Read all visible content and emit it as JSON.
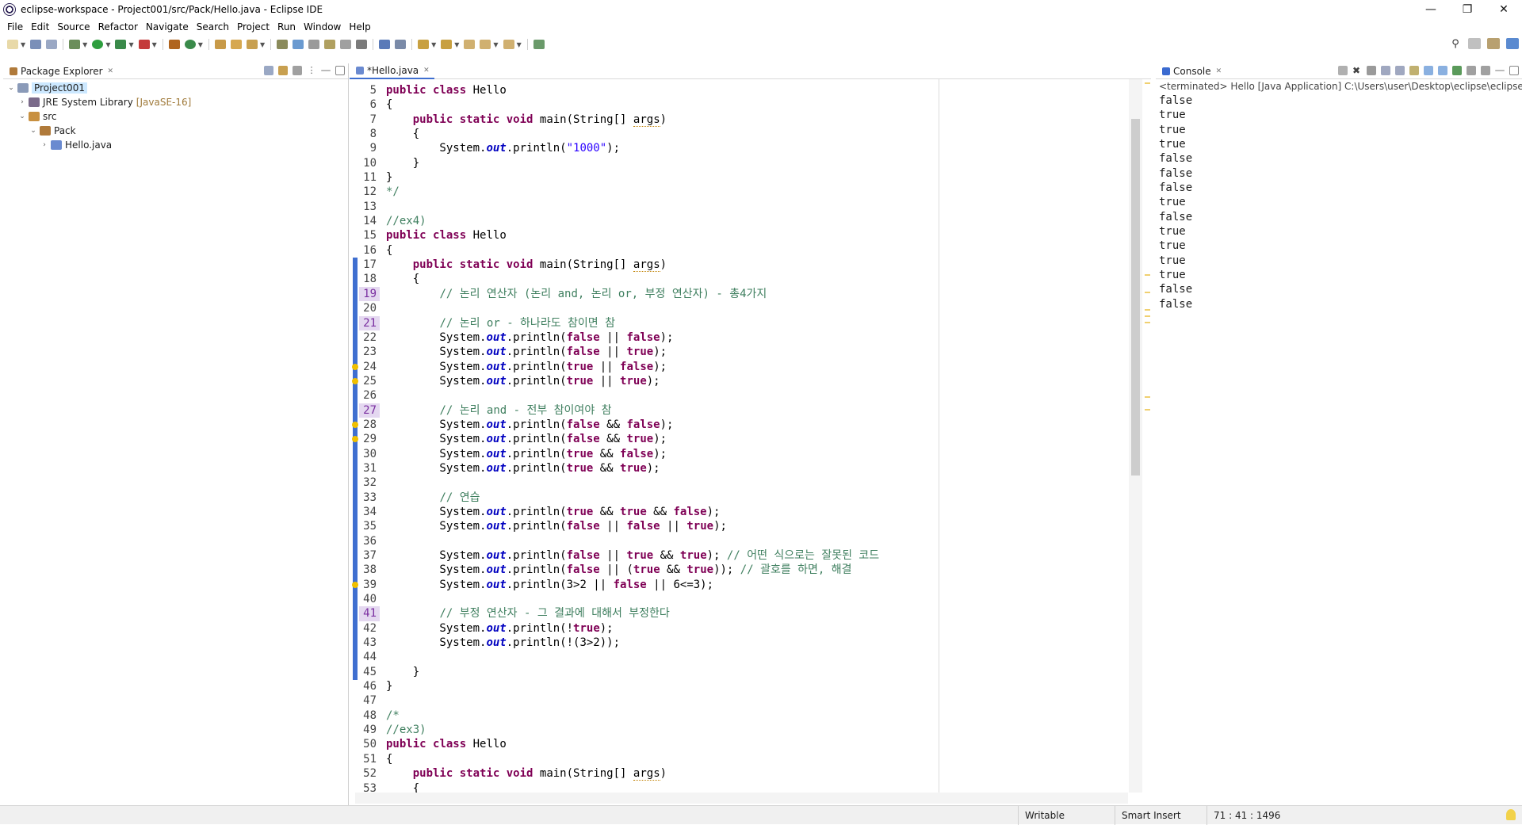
{
  "window": {
    "title": "eclipse-workspace - Project001/src/Pack/Hello.java - Eclipse IDE"
  },
  "menu": [
    "File",
    "Edit",
    "Source",
    "Refactor",
    "Navigate",
    "Search",
    "Project",
    "Run",
    "Window",
    "Help"
  ],
  "package_explorer": {
    "tab_label": "Package Explorer",
    "tree": [
      {
        "label": "Project001",
        "decoration": "",
        "expanded": true,
        "depth": 0,
        "icon": "project-icon",
        "selected": true
      },
      {
        "label": "JRE System Library",
        "decoration": "[JavaSE-16]",
        "expanded": false,
        "depth": 1,
        "icon": "library-icon",
        "selected": false
      },
      {
        "label": "src",
        "decoration": "",
        "expanded": true,
        "depth": 1,
        "icon": "source-folder-icon",
        "selected": false
      },
      {
        "label": "Pack",
        "decoration": "",
        "expanded": true,
        "depth": 2,
        "icon": "package-icon",
        "selected": false
      },
      {
        "label": "Hello.java",
        "decoration": "",
        "expanded": false,
        "depth": 3,
        "icon": "java-file-icon",
        "selected": false
      }
    ]
  },
  "editor": {
    "tab_label": "*Hello.java",
    "lines": [
      {
        "n": "5",
        "text": "public class Hello",
        "hl": false,
        "changed": false,
        "warn": false
      },
      {
        "n": "6",
        "text": "{",
        "hl": false,
        "changed": false,
        "warn": false
      },
      {
        "n": "7",
        "text": "    public static void main(String[] args)",
        "hl": false,
        "changed": false,
        "warn": false
      },
      {
        "n": "8",
        "text": "    {",
        "hl": false,
        "changed": false,
        "warn": false
      },
      {
        "n": "9",
        "text": "        System.out.println(\"1000\");",
        "hl": false,
        "changed": false,
        "warn": false
      },
      {
        "n": "10",
        "text": "    }",
        "hl": false,
        "changed": false,
        "warn": false
      },
      {
        "n": "11",
        "text": "}",
        "hl": false,
        "changed": false,
        "warn": false
      },
      {
        "n": "12",
        "text": "*/",
        "hl": false,
        "changed": false,
        "warn": false
      },
      {
        "n": "13",
        "text": "",
        "hl": false,
        "changed": false,
        "warn": false
      },
      {
        "n": "14",
        "text": "//ex4)",
        "hl": false,
        "changed": false,
        "warn": false
      },
      {
        "n": "15",
        "text": "public class Hello",
        "hl": false,
        "changed": false,
        "warn": false
      },
      {
        "n": "16",
        "text": "{",
        "hl": false,
        "changed": false,
        "warn": false
      },
      {
        "n": "17",
        "text": "    public static void main(String[] args)",
        "hl": false,
        "changed": true,
        "warn": false
      },
      {
        "n": "18",
        "text": "    {",
        "hl": false,
        "changed": true,
        "warn": false
      },
      {
        "n": "19",
        "text": "        // 논리 연산자 (논리 and, 논리 or, 부정 연산자) - 총4가지",
        "hl": true,
        "changed": true,
        "warn": false
      },
      {
        "n": "20",
        "text": "",
        "hl": false,
        "changed": true,
        "warn": false
      },
      {
        "n": "21",
        "text": "        // 논리 or - 하나라도 참이면 참",
        "hl": true,
        "changed": true,
        "warn": false
      },
      {
        "n": "22",
        "text": "        System.out.println(false || false);",
        "hl": false,
        "changed": true,
        "warn": false
      },
      {
        "n": "23",
        "text": "        System.out.println(false || true);",
        "hl": false,
        "changed": true,
        "warn": false
      },
      {
        "n": "24",
        "text": "        System.out.println(true || false);",
        "hl": false,
        "changed": true,
        "warn": true
      },
      {
        "n": "25",
        "text": "        System.out.println(true || true);",
        "hl": false,
        "changed": true,
        "warn": true
      },
      {
        "n": "26",
        "text": "",
        "hl": false,
        "changed": true,
        "warn": false
      },
      {
        "n": "27",
        "text": "        // 논리 and - 전부 참이여야 참",
        "hl": true,
        "changed": true,
        "warn": false
      },
      {
        "n": "28",
        "text": "        System.out.println(false && false);",
        "hl": false,
        "changed": true,
        "warn": true
      },
      {
        "n": "29",
        "text": "        System.out.println(false && true);",
        "hl": false,
        "changed": true,
        "warn": true
      },
      {
        "n": "30",
        "text": "        System.out.println(true && false);",
        "hl": false,
        "changed": true,
        "warn": false
      },
      {
        "n": "31",
        "text": "        System.out.println(true && true);",
        "hl": false,
        "changed": true,
        "warn": false
      },
      {
        "n": "32",
        "text": "",
        "hl": false,
        "changed": true,
        "warn": false
      },
      {
        "n": "33",
        "text": "        // 연습",
        "hl": false,
        "changed": true,
        "warn": false
      },
      {
        "n": "34",
        "text": "        System.out.println(true && true && false);",
        "hl": false,
        "changed": true,
        "warn": false
      },
      {
        "n": "35",
        "text": "        System.out.println(false || false || true);",
        "hl": false,
        "changed": true,
        "warn": false
      },
      {
        "n": "36",
        "text": "",
        "hl": false,
        "changed": true,
        "warn": false
      },
      {
        "n": "37",
        "text": "        System.out.println(false || true && true); // 어떤 식으로는 잘못된 코드",
        "hl": false,
        "changed": true,
        "warn": false
      },
      {
        "n": "38",
        "text": "        System.out.println(false || (true && true)); // 괄호를 하면, 해결",
        "hl": false,
        "changed": true,
        "warn": false
      },
      {
        "n": "39",
        "text": "        System.out.println(3>2 || false || 6<=3);",
        "hl": false,
        "changed": true,
        "warn": true
      },
      {
        "n": "40",
        "text": "",
        "hl": false,
        "changed": true,
        "warn": false
      },
      {
        "n": "41",
        "text": "        // 부정 연산자 - 그 결과에 대해서 부정한다",
        "hl": true,
        "changed": true,
        "warn": false
      },
      {
        "n": "42",
        "text": "        System.out.println(!true);",
        "hl": false,
        "changed": true,
        "warn": false
      },
      {
        "n": "43",
        "text": "        System.out.println(!(3>2));",
        "hl": false,
        "changed": true,
        "warn": false
      },
      {
        "n": "44",
        "text": "",
        "hl": false,
        "changed": true,
        "warn": false
      },
      {
        "n": "45",
        "text": "    }",
        "hl": false,
        "changed": true,
        "warn": false
      },
      {
        "n": "46",
        "text": "}",
        "hl": false,
        "changed": false,
        "warn": false
      },
      {
        "n": "47",
        "text": "",
        "hl": false,
        "changed": false,
        "warn": false
      },
      {
        "n": "48",
        "text": "/*",
        "hl": false,
        "changed": false,
        "warn": false
      },
      {
        "n": "49",
        "text": "//ex3)",
        "hl": false,
        "changed": false,
        "warn": false
      },
      {
        "n": "50",
        "text": "public class Hello",
        "hl": false,
        "changed": false,
        "warn": false
      },
      {
        "n": "51",
        "text": "{",
        "hl": false,
        "changed": false,
        "warn": false
      },
      {
        "n": "52",
        "text": "    public static void main(String[] args)",
        "hl": false,
        "changed": false,
        "warn": false
      },
      {
        "n": "53",
        "text": "    {",
        "hl": false,
        "changed": false,
        "warn": false
      }
    ]
  },
  "console": {
    "tab_label": "Console",
    "header": "<terminated> Hello [Java Application] C:\\Users\\user\\Desktop\\eclipse\\eclipse\\plu",
    "output": [
      "false",
      "true",
      "true",
      "true",
      "false",
      "false",
      "false",
      "true",
      "false",
      "true",
      "true",
      "true",
      "true",
      "false",
      "false"
    ]
  },
  "status": {
    "mode": "Writable",
    "insert": "Smart Insert",
    "position": "71 : 41 : 1496"
  },
  "colors": {
    "keyword": "#7f0055",
    "string": "#2a00ff",
    "comment": "#3f7f5f",
    "field": "#0000c0",
    "change_bar": "#3f6fd0",
    "selection": "#cce8ff"
  }
}
